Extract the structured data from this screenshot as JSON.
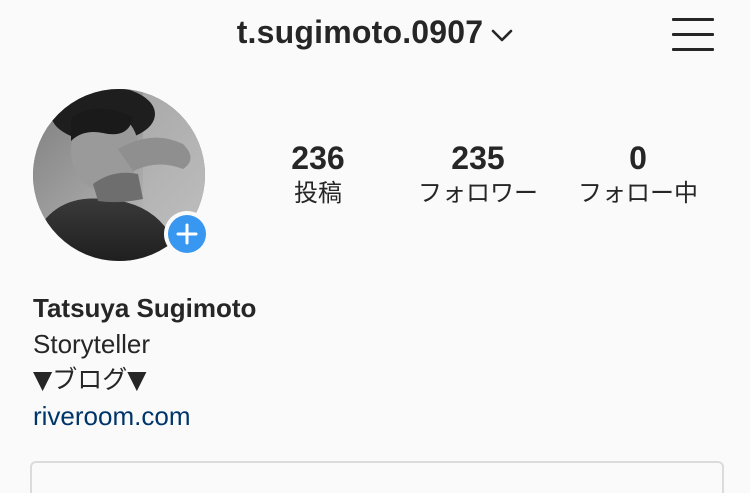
{
  "header": {
    "username": "t.sugimoto.0907"
  },
  "stats": [
    {
      "count": "236",
      "label": "投稿"
    },
    {
      "count": "235",
      "label": "フォロワー"
    },
    {
      "count": "0",
      "label": "フォロー中"
    }
  ],
  "profile": {
    "name": "Tatsuya Sugimoto",
    "bio_line1": "Storyteller",
    "bio_line2": "▼ブログ▼",
    "link": "riveroom.com"
  },
  "colors": {
    "accent": "#3897f0",
    "link": "#003569",
    "text": "#262626",
    "background": "#fafafa"
  }
}
